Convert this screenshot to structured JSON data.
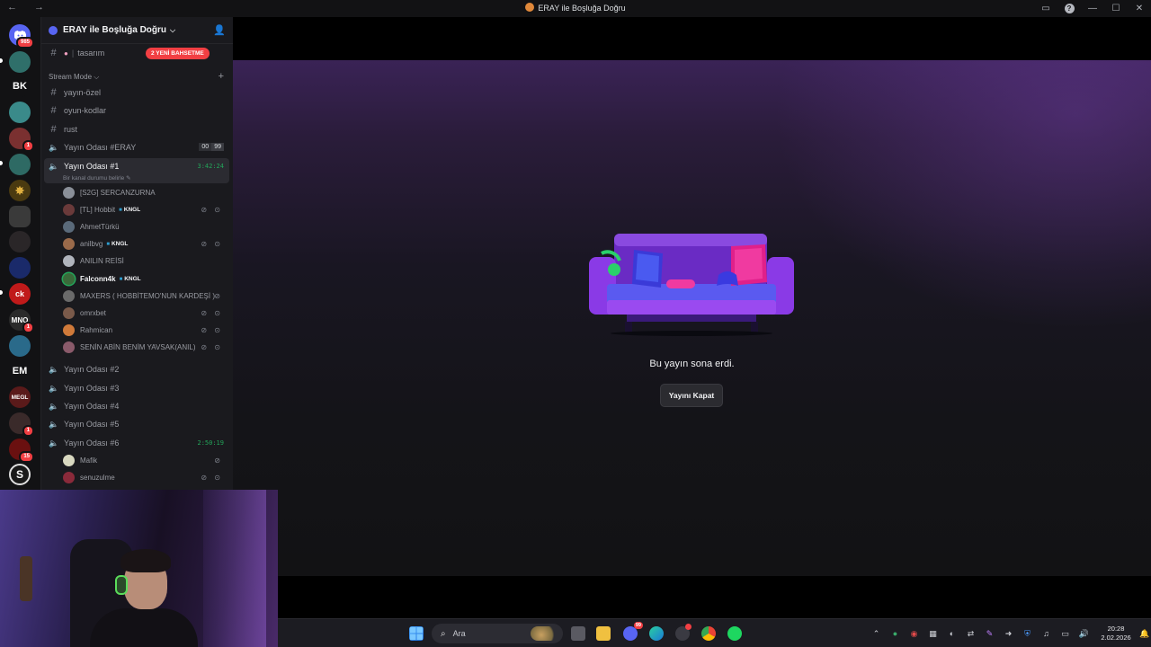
{
  "window": {
    "title": "ERAY ile Boşluğa Doğru",
    "nav": "← →"
  },
  "rail": {
    "home_badge": "985",
    "servers": [
      {
        "name": "staff-server",
        "label": "",
        "badge": ""
      },
      {
        "name": "bk-server",
        "label": "BK",
        "badge": ""
      },
      {
        "name": "teal-server",
        "label": "",
        "badge": ""
      },
      {
        "name": "red-server",
        "label": "",
        "badge": "1"
      },
      {
        "name": "kanal-server",
        "label": "",
        "badge": ""
      },
      {
        "name": "sheriff-server",
        "label": "",
        "badge": ""
      },
      {
        "name": "cars-server",
        "label": "",
        "badge": ""
      },
      {
        "name": "face-server",
        "label": "",
        "badge": ""
      },
      {
        "name": "blue-server",
        "label": "",
        "badge": ""
      },
      {
        "name": "ck-server",
        "label": "",
        "badge": ""
      },
      {
        "name": "mno-server",
        "label": "MNO",
        "badge": "1"
      },
      {
        "name": "santa-server",
        "label": "",
        "badge": ""
      },
      {
        "name": "em-server",
        "label": "EM",
        "badge": ""
      },
      {
        "name": "megl-server",
        "label": "MEGL",
        "badge": ""
      },
      {
        "name": "dark-server",
        "label": "",
        "badge": "1"
      },
      {
        "name": "redstar-server",
        "label": "",
        "badge": "15"
      },
      {
        "name": "s-server",
        "label": "S",
        "badge": ""
      }
    ]
  },
  "sidebar": {
    "guild_name": "ERAY ile Boşluğa Doğru",
    "pinned_channel": "tasarım",
    "mention_pill": "2 YENİ BAHSETME",
    "category": "Stream Mode",
    "text_channels": [
      "yayın-özel",
      "oyun-kodlar",
      "rust"
    ],
    "voice_eray": {
      "name": "Yayın Odası #ERAY",
      "count_a": "00",
      "count_b": "99"
    },
    "voice_1": {
      "name": "Yayın Odası #1",
      "timer": "3:42:24",
      "status": "Bir kanal durumu belirle"
    },
    "users_1": [
      {
        "name": "[S2G] SERCANZURNA",
        "tag": "",
        "icons": "",
        "bold": false
      },
      {
        "name": "[TL] Hobbit",
        "tag": "KNGL",
        "icons": "⊘ ⊙",
        "bold": false
      },
      {
        "name": "AhmetTürkü",
        "tag": "",
        "icons": "",
        "bold": false
      },
      {
        "name": "anilbvg",
        "tag": "KNGL",
        "icons": "⊘ ⊙",
        "bold": false
      },
      {
        "name": "ANILIN REİSİ",
        "tag": "",
        "icons": "",
        "bold": false
      },
      {
        "name": "Falconn4k",
        "tag": "KNGL",
        "icons": "",
        "bold": true
      },
      {
        "name": "MAXERS ( HOBBİTEMO'NUN KARDEŞİ )",
        "tag": "",
        "icons": "⊘",
        "bold": false
      },
      {
        "name": "omrxbet",
        "tag": "",
        "icons": "⊘ ⊙",
        "bold": false
      },
      {
        "name": "Rahmican",
        "tag": "",
        "icons": "⊘ ⊙",
        "bold": false
      },
      {
        "name": "SENİN ABİN BENİM YAVSAK(ANIL)",
        "tag": "",
        "icons": "⊘ ⊙",
        "bold": false
      }
    ],
    "voice_rooms": [
      "Yayın Odası #2",
      "Yayın Odası #3",
      "Yayın Odası #4",
      "Yayın Odası #5"
    ],
    "voice_6": {
      "name": "Yayın Odası #6",
      "timer": "2:50:19"
    },
    "users_6": [
      {
        "name": "Mafik",
        "icons": "⊘"
      },
      {
        "name": "senuzulme",
        "icons": "⊘ ⊙"
      }
    ]
  },
  "stream": {
    "ended_text": "Bu yayın sona erdi.",
    "close_label": "Yayını Kapat"
  },
  "taskbar": {
    "search_placeholder": "Ara",
    "discord_badge": "99",
    "time": "20:28",
    "date": "2.02.2026"
  },
  "colors": {
    "accent_green": "#23a55a",
    "mention_red": "#f23f43",
    "blurple": "#5865f2"
  }
}
